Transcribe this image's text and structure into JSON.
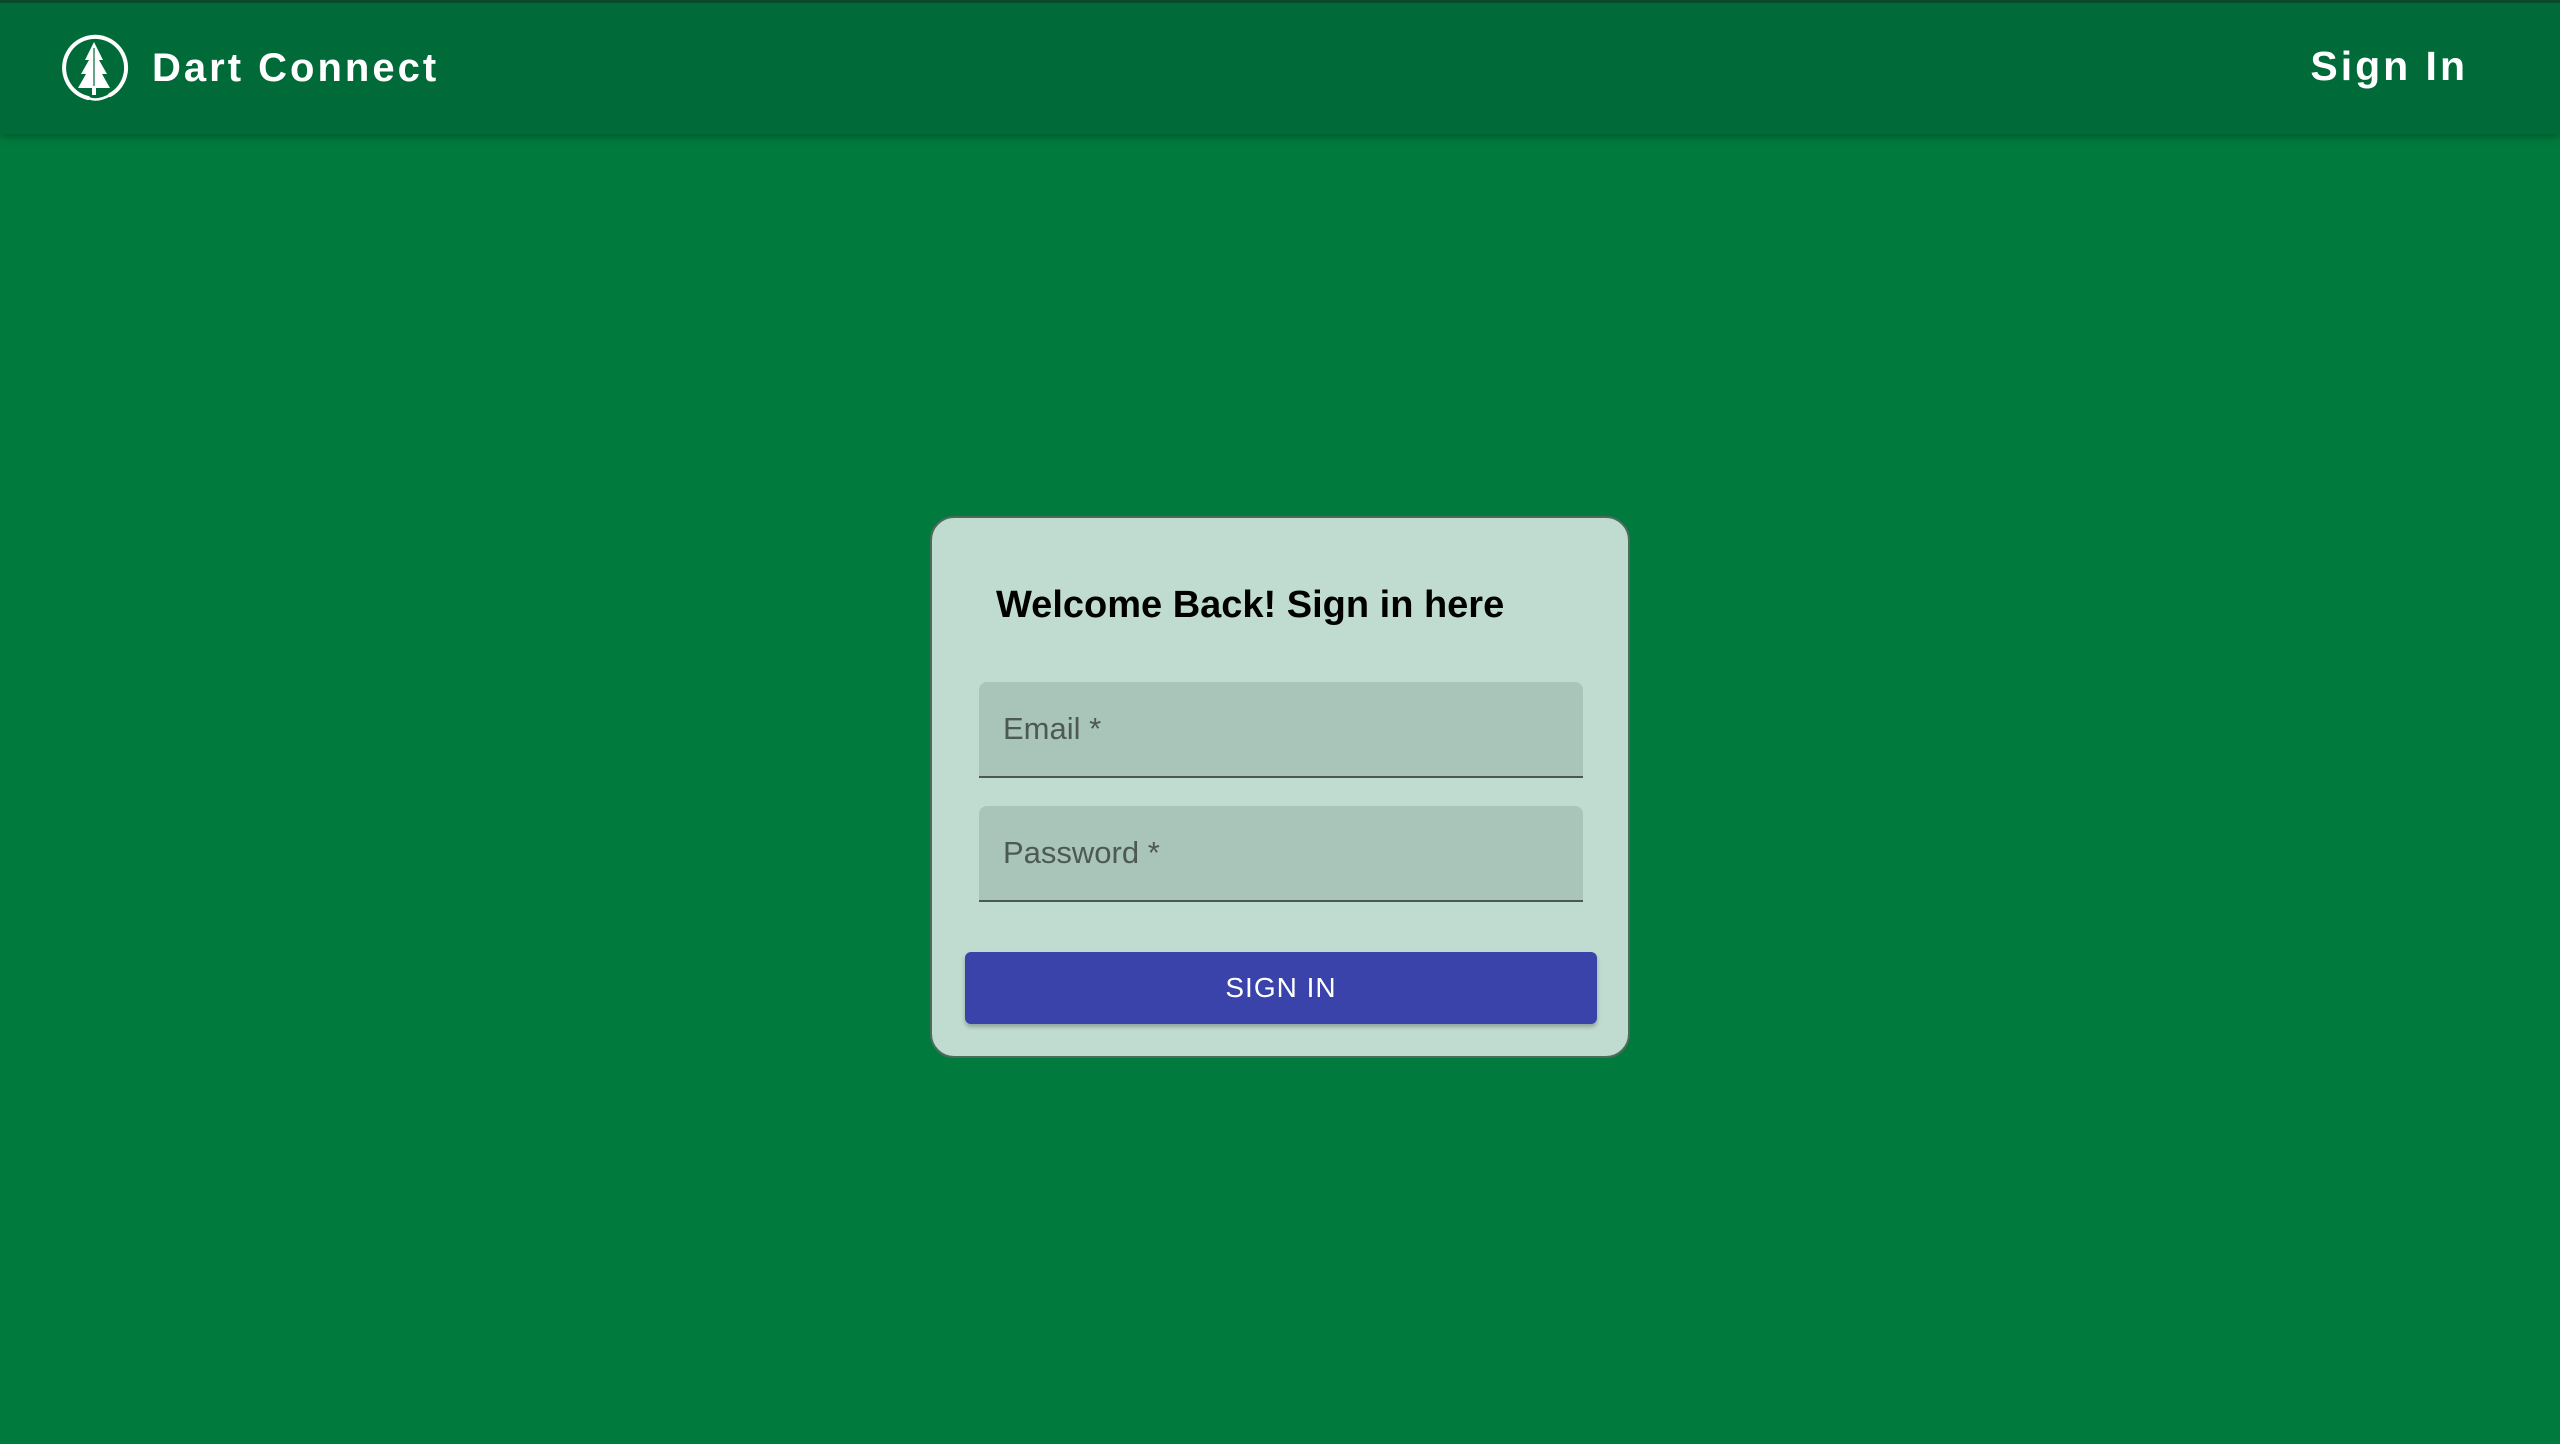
{
  "navbar": {
    "brand": "Dart Connect",
    "logo_icon": "dartmouth-pine-icon",
    "signin_link": "Sign In",
    "background_color": "#006b38"
  },
  "page": {
    "background_color": "#017b3d"
  },
  "login_card": {
    "title": "Welcome Back! Sign in here",
    "email": {
      "placeholder": "Email *",
      "value": ""
    },
    "password": {
      "placeholder": "Password *",
      "value": ""
    },
    "submit_label": "SIGN IN",
    "submit_color": "#3a43a9",
    "background_color": "#c0dcd0"
  }
}
